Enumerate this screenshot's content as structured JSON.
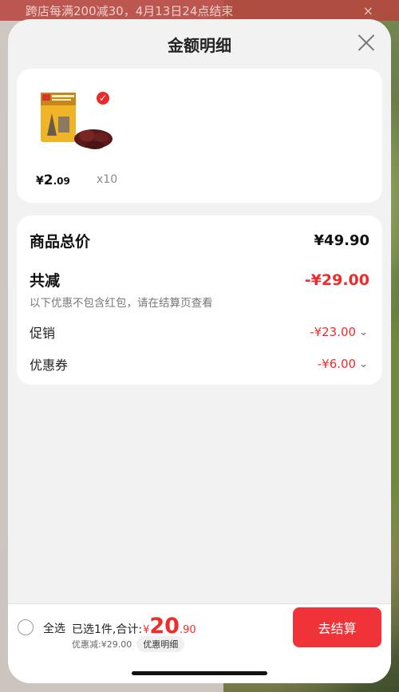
{
  "banner": {
    "text": "跨店每满200减30，4月13日24点结束",
    "close_symbol": "×"
  },
  "sheet": {
    "title": "金额明细"
  },
  "product": {
    "check_symbol": "✓",
    "price_currency": "¥",
    "price_integer": "2",
    "price_decimal": ".09",
    "quantity": "x10"
  },
  "summary": {
    "total_label": "商品总价",
    "total_value": "¥49.90",
    "reduce_label": "共减",
    "reduce_value": "-¥29.00",
    "note": "以下优惠不包含红包，请在结算页查看",
    "items": [
      {
        "label": "促销",
        "value": "-¥23.00"
      },
      {
        "label": "优惠券",
        "value": "-¥6.00"
      }
    ],
    "chevron": "⌄"
  },
  "footer": {
    "select_all_label": "全选",
    "selected_text": "已选1件,合计:",
    "sum_currency": "¥",
    "sum_integer": "20",
    "sum_decimal": ".90",
    "discount_text": "优惠减:¥29.00",
    "detail_label": "优惠明细",
    "checkout_label": "去结算"
  },
  "colors": {
    "accent_red": "#ee2c2c",
    "checkout_button": "#ef3339",
    "sheet_background": "#f2f2f2"
  },
  "icons": [
    "close-icon",
    "check-badge-icon",
    "chevron-down-icon",
    "radio-icon"
  ]
}
